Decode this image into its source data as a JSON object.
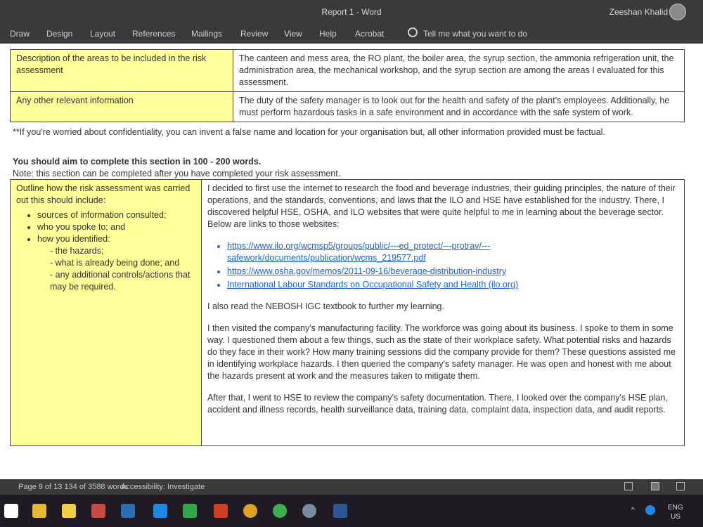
{
  "window": {
    "title": "Report 1 - Word",
    "user": "Zeeshan Khalid"
  },
  "ribbon": {
    "tabs": [
      "Draw",
      "Design",
      "Layout",
      "References",
      "Mailings",
      "Review",
      "View",
      "Help",
      "Acrobat"
    ],
    "tell_me": "Tell me what you want to do"
  },
  "table1": {
    "rows": [
      {
        "label": "Description of the areas to be included in the risk assessment",
        "content": "The canteen and mess area, the RO plant, the boiler area, the syrup section, the ammonia refrigeration unit, the administration area, the mechanical workshop, and the syrup section are among the areas I evaluated for this assessment."
      },
      {
        "label": "Any other relevant information",
        "content": "The duty of the safety manager is to look out for the health and safety of the plant's employees. Additionally, he must perform hazardous tasks in a safe environment and in accordance with the safe system of work."
      }
    ]
  },
  "confidentiality_note": "**If you're worried about confidentiality, you can invent a false name and location for your organisation but, all other information provided must be factual.",
  "section": {
    "instruction": "You should aim to complete this section in 100 - 200 words.",
    "note": "Note: this section can be completed after you have completed your risk assessment."
  },
  "table2": {
    "label_intro": "Outline how the risk assessment was carried out this should include:",
    "label_items": [
      "sources of information consulted;",
      "who you spoke to; and",
      "how you identified:"
    ],
    "label_subitems": [
      "- the hazards;",
      "- what is already being done; and",
      "- any additional controls/actions that may be required."
    ],
    "para1": "I decided to first use the internet to research the food and beverage industries, their guiding principles, the nature of their operations, and the standards, conventions, and laws that the ILO and HSE have established for the industry. There, I discovered helpful HSE, OSHA, and ILO websites that were quite helpful to me in learning about the beverage sector. Below are links to those websites:",
    "links": [
      "https://www.ilo.org/wcmsp5/groups/public/---ed_protect/---protrav/---safework/documents/publication/wcms_219577.pdf",
      "https://www.osha.gov/memos/2011-09-16/beverage-distribution-industry",
      "International Labour Standards on Occupational Safety and Health (ilo.org)"
    ],
    "para2": "I also read the NEBOSH IGC textbook to further my learning.",
    "para3": "I then visited the company's manufacturing facility. The workforce was going about its business. I spoke to them in some way. I questioned them about a few things, such as the state of their workplace safety. What potential risks and hazards do they face in their work? How many training sessions did the company provide for them? These questions assisted me in identifying workplace hazards. I then queried the company's safety manager. He was open and honest with me about the hazards present at work and the measures taken to mitigate them.",
    "para4": "After that, I went to HSE to review the company's safety documentation. There, I looked over the company's HSE plan, accident and illness records, health surveillance data, training data, complaint data, inspection data, and audit reports."
  },
  "statusbar": {
    "pages": "Page 9 of 13 134 of 3588 words",
    "accessibility": "Accessibility: Investigate"
  },
  "taskbar": {
    "lang": "ENG",
    "region": "US"
  }
}
